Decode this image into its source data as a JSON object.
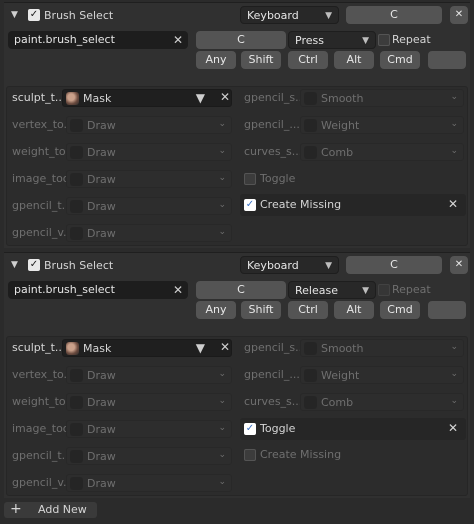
{
  "items": [
    {
      "name": "Brush Select",
      "map_type": "Keyboard",
      "key": "C",
      "idname": "paint.brush_select",
      "key_button": "C",
      "value": "Press",
      "repeat_label": "Repeat",
      "modifiers": [
        "Any",
        "Shift",
        "Ctrl",
        "Alt",
        "Cmd"
      ],
      "left_tools": [
        {
          "label": "sculpt_t...",
          "value": "Mask"
        },
        {
          "label": "vertex_to...",
          "value": "Draw"
        },
        {
          "label": "weight_to...",
          "value": "Draw"
        },
        {
          "label": "image_tool:",
          "value": "Draw"
        },
        {
          "label": "gpencil_t...",
          "value": "Draw"
        },
        {
          "label": "gpencil_v...",
          "value": "Draw"
        }
      ],
      "right_tools": [
        {
          "label": "gpencil_s...",
          "value": "Smooth"
        },
        {
          "label": "gpencil_...",
          "value": "Weight"
        },
        {
          "label": "curves_s...",
          "value": "Comb"
        }
      ],
      "toggle_label": "Toggle",
      "create_missing_label": "Create Missing"
    },
    {
      "name": "Brush Select",
      "map_type": "Keyboard",
      "key": "C",
      "idname": "paint.brush_select",
      "key_button": "C",
      "value": "Release",
      "repeat_label": "Repeat",
      "modifiers": [
        "Any",
        "Shift",
        "Ctrl",
        "Alt",
        "Cmd"
      ],
      "left_tools": [
        {
          "label": "sculpt_t...",
          "value": "Mask"
        },
        {
          "label": "vertex_to...",
          "value": "Draw"
        },
        {
          "label": "weight_to...",
          "value": "Draw"
        },
        {
          "label": "image_tool:",
          "value": "Draw"
        },
        {
          "label": "gpencil_t...",
          "value": "Draw"
        },
        {
          "label": "gpencil_v...",
          "value": "Draw"
        }
      ],
      "right_tools": [
        {
          "label": "gpencil_s...",
          "value": "Smooth"
        },
        {
          "label": "gpencil_...",
          "value": "Weight"
        },
        {
          "label": "curves_s...",
          "value": "Comb"
        }
      ],
      "toggle_label": "Toggle",
      "create_missing_label": "Create Missing"
    }
  ],
  "add_new_label": "Add New"
}
